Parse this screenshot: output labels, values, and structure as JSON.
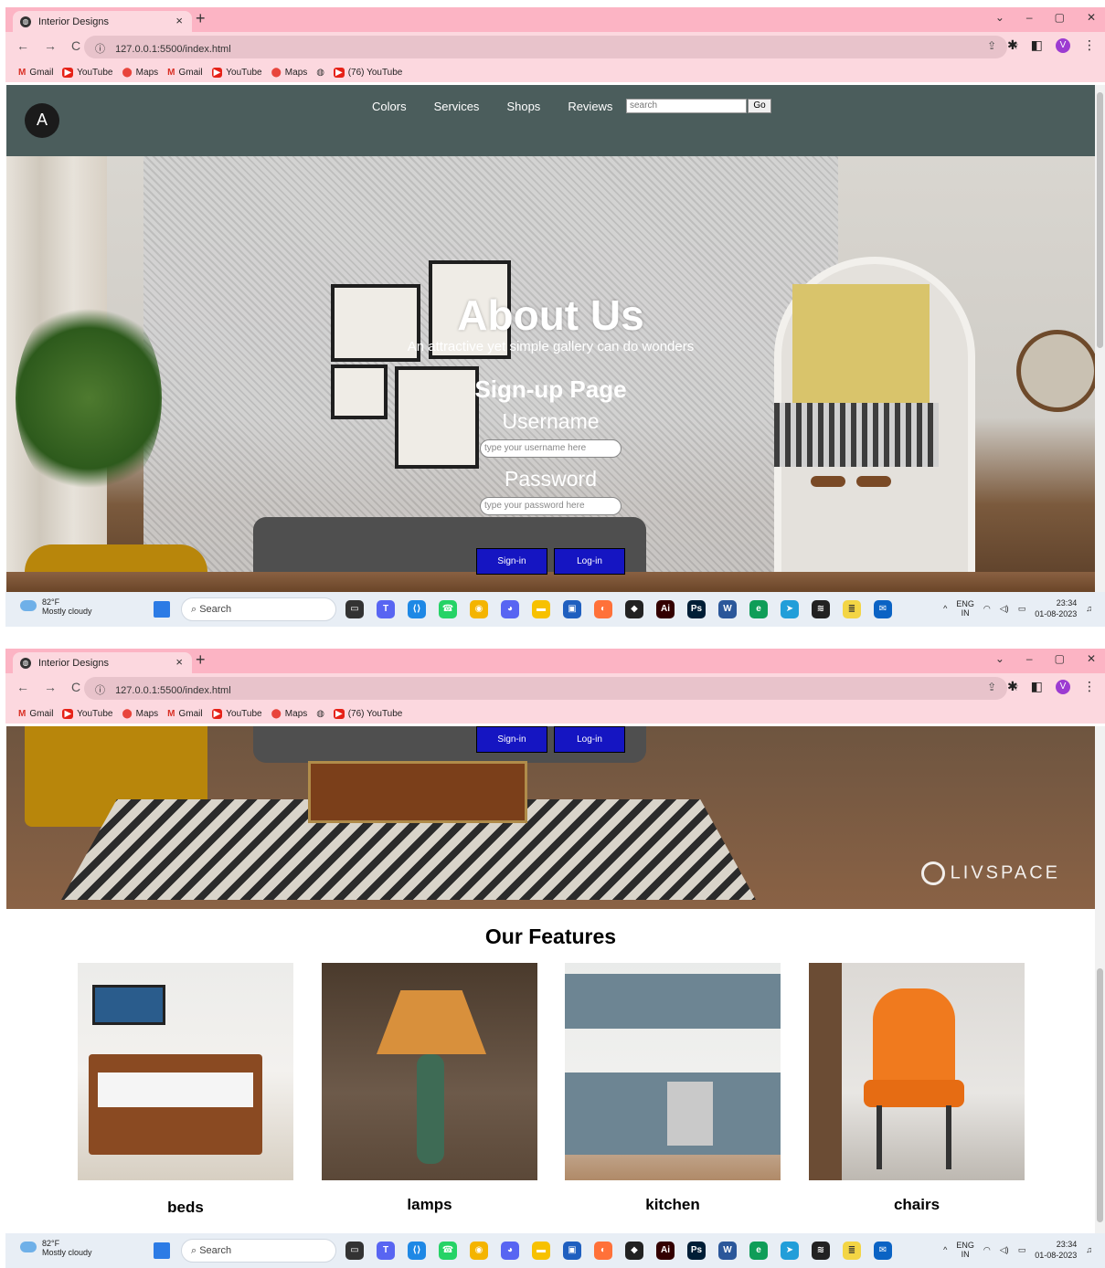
{
  "browser": {
    "tab_title": "Interior Designs",
    "tab_close": "×",
    "new_tab": "+",
    "url": "127.0.0.1:5500/index.html",
    "window_buttons": [
      "⌄",
      "–",
      "▢",
      "✕"
    ],
    "nav_back": "←",
    "nav_forward": "→",
    "nav_reload": "C",
    "profile_initial": "V",
    "bookmarks": [
      {
        "label": "Gmail",
        "icon": "gmail-icon",
        "glyph": "M"
      },
      {
        "label": "YouTube",
        "icon": "youtube-icon",
        "glyph": "▶"
      },
      {
        "label": "Maps",
        "icon": "maps-icon",
        "glyph": "⬤"
      },
      {
        "label": "Gmail",
        "icon": "gmail-icon",
        "glyph": "M"
      },
      {
        "label": "YouTube",
        "icon": "youtube-icon",
        "glyph": "▶"
      },
      {
        "label": "Maps",
        "icon": "maps-icon",
        "glyph": "⬤"
      },
      {
        "label": "",
        "icon": "globe-icon",
        "glyph": "◍"
      },
      {
        "label": "(76) YouTube",
        "icon": "youtube-icon",
        "glyph": "▶"
      }
    ]
  },
  "page": {
    "logo_glyph": "A",
    "nav": [
      "Colors",
      "Services",
      "Shops",
      "Reviews"
    ],
    "search_placeholder": "search",
    "search_button": "Go",
    "hero": {
      "title": "About Us",
      "subtitle": "An attractive yet simple gallery can do wonders",
      "signup_title": "Sign-up Page",
      "username_label": "Username",
      "username_placeholder": "type your username here",
      "password_label": "Password",
      "password_placeholder": "type your password here",
      "signin_button": "Sign-in",
      "login_button": "Log-in",
      "watermark": "LIVSPACE"
    },
    "features": {
      "title": "Our Features",
      "items": [
        "beds",
        "lamps",
        "kitchen",
        "chairs"
      ]
    }
  },
  "taskbar": {
    "temperature": "82°F",
    "weather": "Mostly cloudy",
    "search": "Search",
    "lang": "ENG",
    "region": "IN",
    "time": "23:34",
    "date": "01-08-2023"
  },
  "colors": {
    "titlebar": "#fcb4c4",
    "toolbar": "#fcd8df",
    "header": "#4b5d5c",
    "button": "#1515c2"
  }
}
